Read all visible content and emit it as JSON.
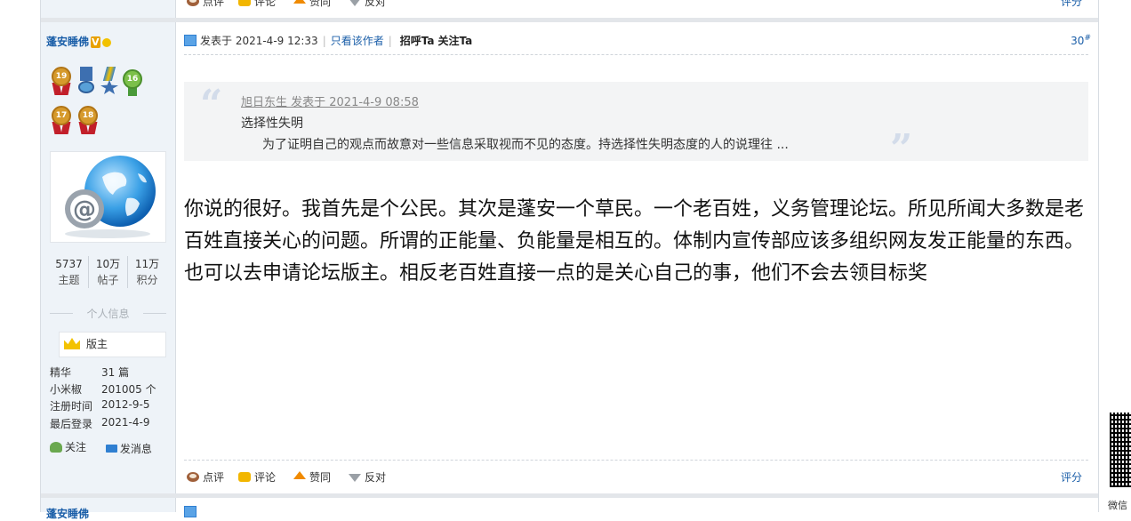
{
  "prev_post": {
    "actions": [
      "点评",
      "评论",
      "赞同",
      "反对"
    ],
    "rate_label": "评分"
  },
  "user": {
    "name": "蓬安睡佛",
    "verified_badge": "V",
    "medals": [
      "19",
      "",
      "",
      "16",
      "17",
      "18"
    ],
    "stats": [
      {
        "value": "5737",
        "label": "主题"
      },
      {
        "value": "10万",
        "label": "帖子"
      },
      {
        "value": "11万",
        "label": "积分"
      }
    ],
    "personal_info_heading": "个人信息",
    "role": "版主",
    "details": [
      {
        "key": "精华",
        "value": "31 篇"
      },
      {
        "key": "小米椒",
        "value": "201005 个"
      },
      {
        "key": "注册时间",
        "value": "2012-9-5"
      },
      {
        "key": "最后登录",
        "value": "2021-4-9"
      }
    ],
    "follow_label": "关注",
    "message_label": "发消息"
  },
  "post": {
    "posted_at": "发表于 2021-4-9 12:33",
    "only_author": "只看该作者",
    "greet": "招呼Ta",
    "follow": "关注Ta",
    "floor": "30",
    "floor_mark": "#",
    "quote": {
      "header": "旭日东生 发表于 2021-4-9 08:58",
      "title": "选择性失明",
      "excerpt": "为了证明自己的观点而故意对一些信息采取视而不见的态度。持选择性失明态度的人的说理往 ..."
    },
    "content": "你说的很好。我首先是个公民。其次是蓬安一个草民。一个老百姓，义务管理论坛。所见所闻大多数是老百姓直接关心的问题。所谓的正能量、负能量是相互的。体制内宣传部应该多组织网友发正能量的东西。也可以去申请论坛版主。相反老百姓直接一点的是关心自己的事，他们不会去领目标奖",
    "actions": [
      "点评",
      "评论",
      "赞同",
      "反对"
    ],
    "rate_label": "评分"
  },
  "next_post": {
    "user_name": "蓬安睡佛"
  },
  "qr_label": "微信"
}
